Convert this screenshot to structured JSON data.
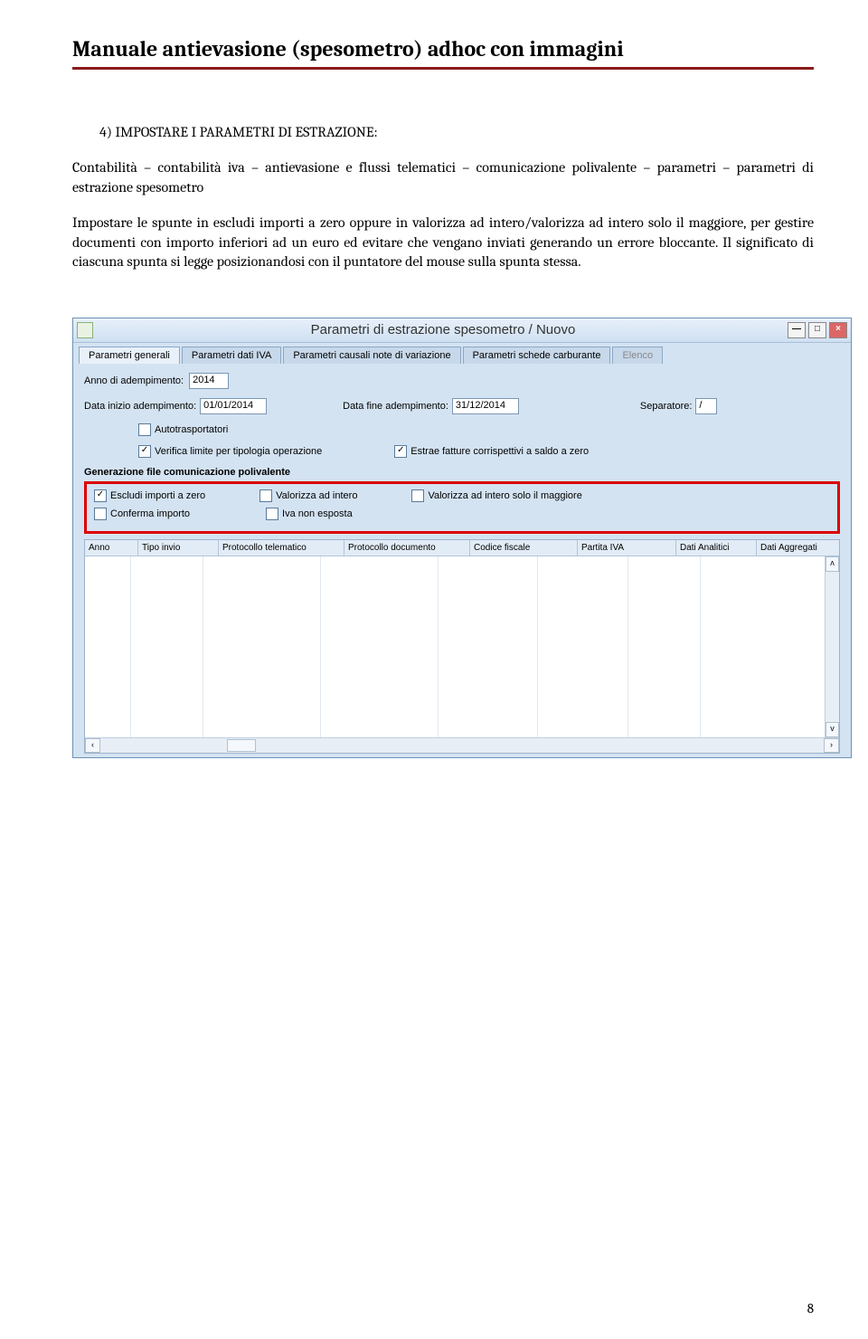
{
  "doc": {
    "title": "Manuale antievasione (spesometro) adhoc con immagini",
    "page_number": "8",
    "heading": "4)   IMPOSTARE I PARAMETRI DI ESTRAZIONE:",
    "p1": "Contabilità – contabilità iva – antievasione e flussi telematici – comunicazione polivalente – parametri – parametri di estrazione spesometro",
    "p2": "Impostare le spunte in escludi importi a zero oppure in valorizza ad intero/valorizza ad intero solo il maggiore, per gestire documenti con importo inferiori ad un euro ed evitare che vengano inviati generando un errore bloccante. Il significato di ciascuna spunta si legge posizionandosi con il puntatore del mouse sulla spunta stessa."
  },
  "window": {
    "title": "Parametri di estrazione spesometro / Nuovo",
    "tabs": [
      "Parametri generali",
      "Parametri dati IVA",
      "Parametri causali note di variazione",
      "Parametri schede carburante",
      "Elenco"
    ],
    "labels": {
      "anno": "Anno di adempimento:",
      "data_inizio": "Data inizio adempimento:",
      "data_fine": "Data fine adempimento:",
      "separatore": "Separatore:"
    },
    "values": {
      "anno": "2014",
      "data_inizio": "01/01/2014",
      "data_fine": "31/12/2014",
      "separatore": "/"
    },
    "checks": {
      "autotrasportatori": "Autotrasportatori",
      "verifica": "Verifica limite per tipologia operazione",
      "estrae": "Estrae fatture corrispettivi a saldo a zero",
      "escludi": "Escludi importi a zero",
      "valorizza": "Valorizza ad intero",
      "valorizza_magg": "Valorizza ad intero solo il maggiore",
      "conferma": "Conferma importo",
      "iva_non_esposta": "Iva non esposta"
    },
    "section": "Generazione file comunicazione polivalente",
    "grid_headers": [
      "Anno",
      "Tipo invio",
      "Protocollo telematico",
      "Protocollo documento",
      "Codice fiscale",
      "Partita IVA",
      "Dati Analitici",
      "Dati Aggregati"
    ]
  }
}
